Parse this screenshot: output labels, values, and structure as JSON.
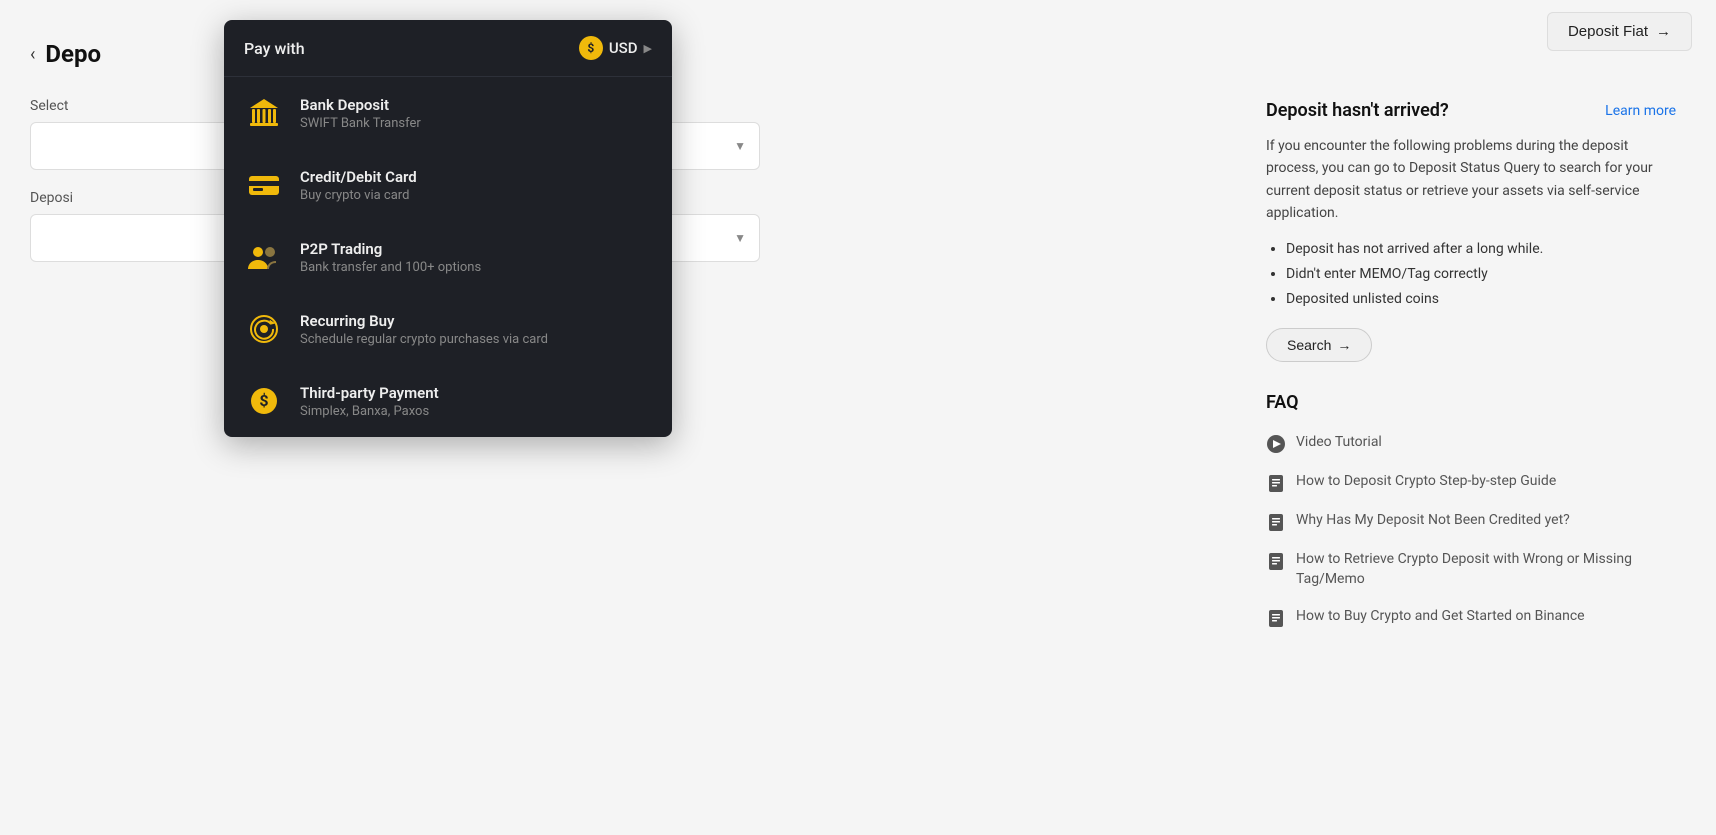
{
  "header": {
    "deposit_fiat_label": "Deposit Fiat",
    "deposit_fiat_arrow": "→"
  },
  "back": {
    "arrow": "‹",
    "title": "Depo"
  },
  "left": {
    "select_label": "Select",
    "deposit_label": "Deposi",
    "select_placeholder": "",
    "deposit_placeholder": ""
  },
  "dropdown_menu": {
    "pay_with_label": "Pay with",
    "currency_label": "USD",
    "currency_symbol": "$",
    "items": [
      {
        "id": "bank-deposit",
        "title": "Bank Deposit",
        "subtitle": "SWIFT Bank Transfer",
        "icon": "bank"
      },
      {
        "id": "credit-debit-card",
        "title": "Credit/Debit Card",
        "subtitle": "Buy crypto via card",
        "icon": "card"
      },
      {
        "id": "p2p-trading",
        "title": "P2P Trading",
        "subtitle": "Bank transfer and 100+ options",
        "icon": "p2p"
      },
      {
        "id": "recurring-buy",
        "title": "Recurring Buy",
        "subtitle": "Schedule regular crypto purchases via card",
        "icon": "recurring"
      },
      {
        "id": "third-party-payment",
        "title": "Third-party Payment",
        "subtitle": "Simplex, Banxa, Paxos",
        "icon": "thirdparty"
      }
    ]
  },
  "right_sidebar": {
    "alert_title": "Deposit hasn't arrived?",
    "learn_more_label": "Learn more",
    "alert_text": "If you encounter the following problems during the deposit process, you can go to Deposit Status Query to search for your current deposit status or retrieve your assets via self-service application.",
    "bullets": [
      "Deposit has not arrived after a long while.",
      "Didn't enter MEMO/Tag correctly",
      "Deposited unlisted coins"
    ],
    "search_btn_label": "Search",
    "search_btn_arrow": "→",
    "faq_title": "FAQ",
    "faq_items": [
      {
        "id": "video-tutorial",
        "type": "video",
        "label": "Video Tutorial"
      },
      {
        "id": "deposit-guide",
        "type": "doc",
        "label": "How to Deposit Crypto Step-by-step Guide"
      },
      {
        "id": "deposit-not-credited",
        "type": "doc",
        "label": "Why Has My Deposit Not Been Credited yet?"
      },
      {
        "id": "wrong-tag-memo",
        "type": "doc",
        "label": "How to Retrieve Crypto Deposit with Wrong or Missing Tag/Memo"
      },
      {
        "id": "get-started",
        "type": "doc",
        "label": "How to Buy Crypto and Get Started on Binance"
      }
    ]
  }
}
